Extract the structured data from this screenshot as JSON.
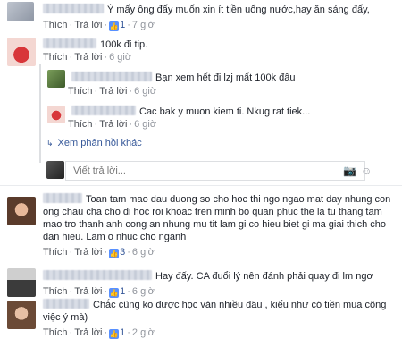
{
  "comments": [
    {
      "text": "Ý mấy ông đấy muốn xin ít tiền uống nước,hay ăn sáng đấy,",
      "like": "Thích",
      "reply": "Trả lời",
      "likes": "1",
      "time": "7 giờ"
    },
    {
      "text": "100k đi tip.",
      "like": "Thích",
      "reply": "Trả lời",
      "likes": "",
      "time": "6 giờ"
    },
    {
      "text": "Toan tam mao dau duong so cho hoc thi ngo ngao mat day nhung con ong chau cha cho di hoc roi khoac tren minh bo quan phuc the la tu thang tam mao tro thanh anh cong an nhung mu tit lam gi co hieu biet gi ma giai thich cho dan hieu. Lam o nhuc cho nganh",
      "like": "Thích",
      "reply": "Trả lời",
      "likes": "3",
      "time": "6 giờ"
    },
    {
      "text": "Hay đấy. CA đuổi lý nên đánh phải quay đi lm ngơ",
      "like": "Thích",
      "reply": "Trả lời",
      "likes": "1",
      "time": "6 giờ"
    },
    {
      "text": "Chắc cũng ko được học văn nhiều đâu , kiểu như có tiền mua công việc ý mà)",
      "like": "Thích",
      "reply": "Trả lời",
      "likes": "1",
      "time": "2 giờ"
    }
  ],
  "replies": [
    {
      "text": "Bạn xem hết đi lzj mất 100k đâu",
      "like": "Thích",
      "reply": "Trả lời",
      "time": "6 giờ"
    },
    {
      "text": "Cac bak y muon kiem ti. Nkug rat tiek...",
      "like": "Thích",
      "reply": "Trả lời",
      "time": "6 giờ"
    }
  ],
  "more_replies": "Xem phản hồi khác",
  "reply_input": {
    "placeholder": "Viết trả lời..."
  },
  "colors": {
    "link": "#365899",
    "meta": "#90949c",
    "like_blue": "#5890ff"
  },
  "icons": [
    "camera-icon",
    "smiley-icon",
    "like-icon",
    "reply-arrow-icon"
  ]
}
